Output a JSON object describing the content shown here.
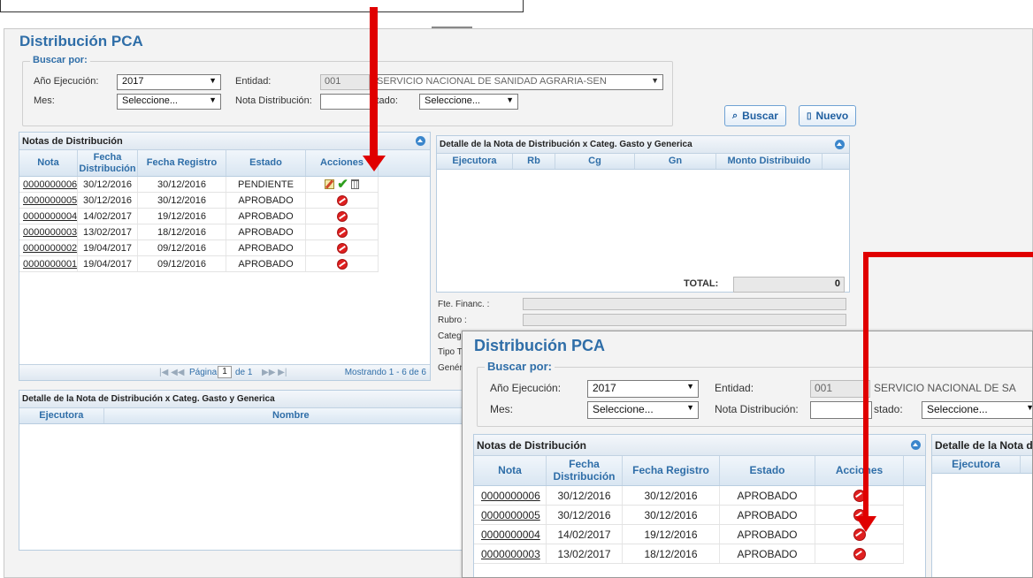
{
  "page_title": "Distribución PCA",
  "search": {
    "legend": "Buscar por:",
    "anio_label": "Año Ejecución:",
    "anio_value": "2017",
    "entidad_label": "Entidad:",
    "entidad_code": "001",
    "entidad_name": "SERVICIO NACIONAL DE SANIDAD AGRARIA-SEN",
    "entidad_name_short": "SERVICIO NACIONAL DE SA",
    "mes_label": "Mes:",
    "mes_value": "Seleccione...",
    "nota_label": "Nota Distribución:",
    "nota_value": "",
    "estado_label": "Estado:",
    "estado_label_cut": "stado:",
    "estado_value": "Seleccione...",
    "buscar_label": "Buscar",
    "nuevo_label": "Nuevo"
  },
  "notas_panel": {
    "title": "Notas de Distribución",
    "columns": [
      "Nota",
      "Fecha Distribución",
      "Fecha Registro",
      "Estado",
      "Acciones"
    ],
    "rows": [
      {
        "nota": "0000000006",
        "fecha_dist": "30/12/2016",
        "fecha_reg": "30/12/2016",
        "estado": "PENDIENTE",
        "accion": "edit-approve-delete"
      },
      {
        "nota": "0000000005",
        "fecha_dist": "30/12/2016",
        "fecha_reg": "30/12/2016",
        "estado": "APROBADO",
        "accion": "cancel"
      },
      {
        "nota": "0000000004",
        "fecha_dist": "14/02/2017",
        "fecha_reg": "19/12/2016",
        "estado": "APROBADO",
        "accion": "cancel"
      },
      {
        "nota": "0000000003",
        "fecha_dist": "13/02/2017",
        "fecha_reg": "18/12/2016",
        "estado": "APROBADO",
        "accion": "cancel"
      },
      {
        "nota": "0000000002",
        "fecha_dist": "19/04/2017",
        "fecha_reg": "09/12/2016",
        "estado": "APROBADO",
        "accion": "cancel"
      },
      {
        "nota": "0000000001",
        "fecha_dist": "19/04/2017",
        "fecha_reg": "09/12/2016",
        "estado": "APROBADO",
        "accion": "cancel"
      }
    ],
    "pager_page_label": "Página",
    "pager_page_value": "1",
    "pager_of": "de 1",
    "pager_summary": "Mostrando 1 - 6 de 6"
  },
  "detalle_categ_panel": {
    "title": "Detalle de la Nota de Distribución x Categ. Gasto y Generica",
    "columns": [
      "Ejecutora",
      "Rb",
      "Cg",
      "Gn",
      "Monto Distribuido"
    ],
    "total_label": "TOTAL:",
    "total_value": "0"
  },
  "fuente_fields": {
    "fte_label": "Fte. Financ. :",
    "rubro_label": "Rubro :",
    "categ_label": "Categ",
    "tipo_label": "Tipo T",
    "gene_label": "Genér"
  },
  "detalle_bottom_panel": {
    "title": "Detalle de la Nota de Distribución x Categ. Gasto y Generica",
    "columns": [
      "Ejecutora",
      "Nombre"
    ]
  },
  "zoom_panel": {
    "title": "Notas de Distribución",
    "detalle_title_cut": "Detalle de la Nota de",
    "detalle_col": "Ejecutora",
    "rows": [
      {
        "nota": "0000000006",
        "fecha_dist": "30/12/2016",
        "fecha_reg": "30/12/2016",
        "estado": "APROBADO"
      },
      {
        "nota": "0000000005",
        "fecha_dist": "30/12/2016",
        "fecha_reg": "30/12/2016",
        "estado": "APROBADO"
      },
      {
        "nota": "0000000004",
        "fecha_dist": "14/02/2017",
        "fecha_reg": "19/12/2016",
        "estado": "APROBADO"
      },
      {
        "nota": "0000000003",
        "fecha_dist": "13/02/2017",
        "fecha_reg": "18/12/2016",
        "estado": "APROBADO"
      }
    ]
  },
  "colors": {
    "accent": "#2f6ea8",
    "annotation_arrow": "#e00000",
    "cancel_icon": "#e02020",
    "approve_icon": "#2e9e1e"
  }
}
